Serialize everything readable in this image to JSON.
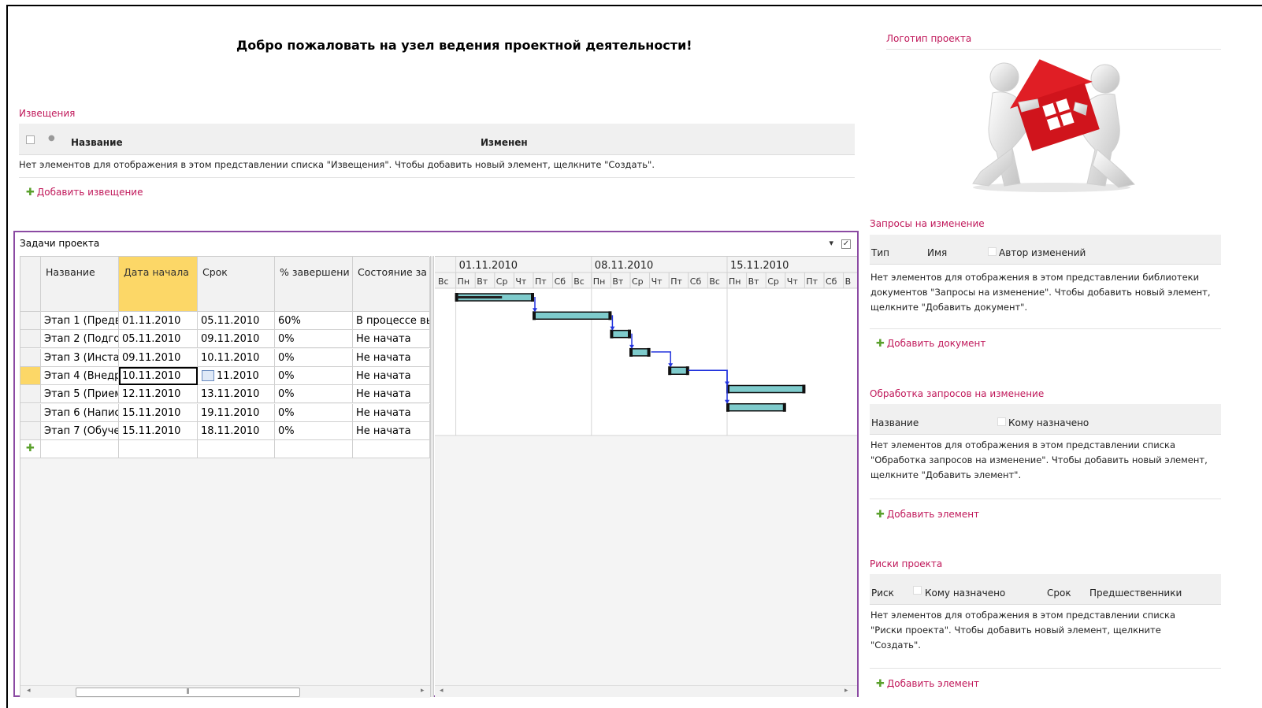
{
  "welcome": "Добро пожаловать на узел ведения проектной деятельности!",
  "notices": {
    "title": "Извещения",
    "col_name": "Название",
    "col_modified": "Изменен",
    "empty": "Нет элементов для отображения в этом представлении списка \"Извещения\". Чтобы добавить новый элемент, щелкните \"Создать\".",
    "add": "Добавить извещение"
  },
  "tasks": {
    "title": "Задачи проекта",
    "columns": [
      "Название",
      "Дата начала",
      "Срок",
      "% завершени",
      "Состояние за"
    ],
    "rows": [
      [
        "Этап 1 (Предв",
        "01.11.2010",
        "05.11.2010",
        "60%",
        "В процессе вь"
      ],
      [
        "Этап 2 (Подгот",
        "05.11.2010",
        "09.11.2010",
        "0%",
        "Не начата"
      ],
      [
        "Этап 3 (Инста",
        "09.11.2010",
        "10.11.2010",
        "0%",
        "Не начата"
      ],
      [
        "Этап 4 (Внедр",
        "10.11.2010",
        "11.2010",
        "0%",
        "Не начата"
      ],
      [
        "Этап 5 (Прием",
        "12.11.2010",
        "13.11.2010",
        "0%",
        "Не начата"
      ],
      [
        "Этап 6 (Напис",
        "15.11.2010",
        "19.11.2010",
        "0%",
        "Не начата"
      ],
      [
        "Этап 7 (Обуче",
        "15.11.2010",
        "18.11.2010",
        "0%",
        "Не начата"
      ]
    ],
    "gantt": {
      "weeks": [
        "01.11.2010",
        "08.11.2010",
        "15.11.2010"
      ],
      "days": [
        "Вс",
        "Пн",
        "Вт",
        "Ср",
        "Чт",
        "Пт",
        "Сб",
        "Вс",
        "Пн",
        "Вт",
        "Ср",
        "Чт",
        "Пт",
        "Сб",
        "Вс",
        "Пн",
        "Вт",
        "Ср",
        "Чт",
        "Пт",
        "Сб",
        "В"
      ]
    }
  },
  "logo_section": {
    "title": "Логотип проекта"
  },
  "change_requests": {
    "title": "Запросы на изменение",
    "col_type": "Тип",
    "col_name": "Имя",
    "col_author": "Автор изменений",
    "empty": "Нет элементов для отображения в этом представлении библиотеки документов \"Запросы на изменение\". Чтобы добавить новый элемент, щелкните \"Добавить документ\".",
    "add": "Добавить документ"
  },
  "change_processing": {
    "title": "Обработка запросов на изменение",
    "col_name": "Название",
    "col_assigned": "Кому назначено",
    "empty": "Нет элементов для отображения в этом представлении списка \"Обработка запросов на изменение\". Чтобы добавить новый элемент, щелкните \"Добавить элемент\".",
    "add": "Добавить элемент"
  },
  "risks": {
    "title": "Риски проекта",
    "col_risk": "Риск",
    "col_assigned": "Кому назначено",
    "col_due": "Срок",
    "col_pred": "Предшественники",
    "empty": "Нет элементов для отображения в этом представлении списка \"Риски проекта\". Чтобы добавить новый элемент, щелкните \"Создать\".",
    "add": "Добавить элемент"
  },
  "colors": {
    "accent": "#c0185a",
    "task_frame": "#8b4aa3",
    "selected": "#fcd767",
    "bar": "#7ecbcc"
  },
  "icons": {
    "add": "plus-icon",
    "calendar": "calendar-icon",
    "attachment": "attachment-icon"
  }
}
